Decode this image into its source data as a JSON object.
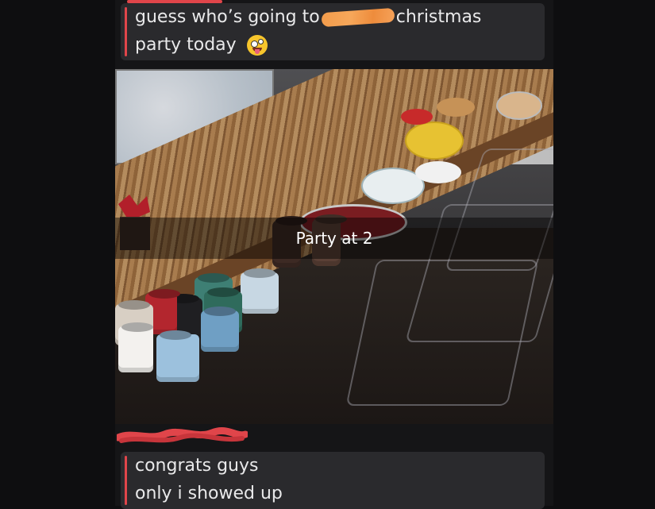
{
  "messages": {
    "first": {
      "line1_start": "guess who’s going to",
      "line1_end": "christmas",
      "line2": "party today",
      "emoji": "zany-face-emoji"
    },
    "second": {
      "line1": "congrats guys",
      "line2": "only i showed up"
    }
  },
  "snap": {
    "caption": "Party at 2"
  },
  "colors": {
    "background": "#0e0e10",
    "bubble": "#2a2a2d",
    "accent_bar": "#e0454a",
    "redaction_orange": "#f39c4b",
    "redaction_red": "#e0454a",
    "text": "#e9e9ea"
  }
}
